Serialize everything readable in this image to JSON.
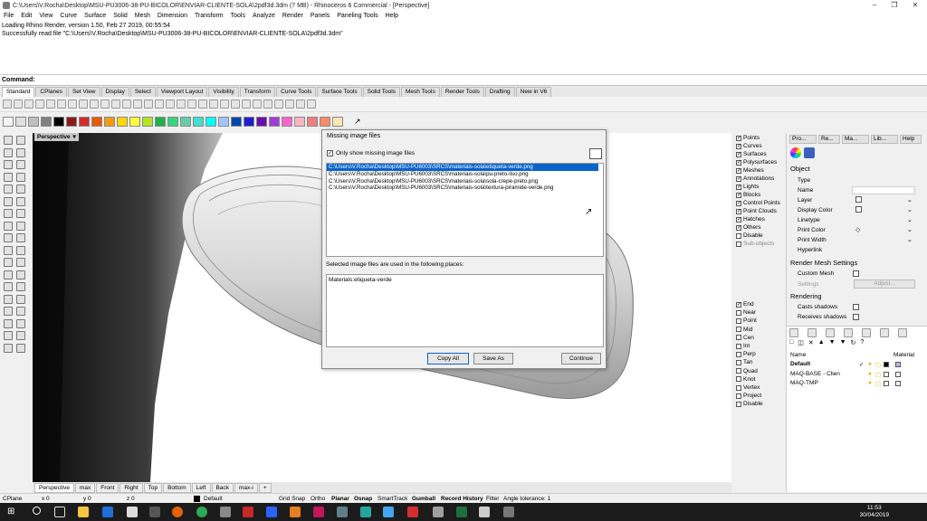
{
  "window": {
    "title": "C:\\Users\\V.Rocha\\Desktop\\MSU-PU3006-38-PU-BICOLOR\\ENVIAR-CLIENTE-SOLA\\2pdf3d.3dm (7 MB) - Rhinoceros 6 Commercial - [Perspective]"
  },
  "menu": [
    "File",
    "Edit",
    "View",
    "Curve",
    "Surface",
    "Solid",
    "Mesh",
    "Dimension",
    "Transform",
    "Tools",
    "Analyze",
    "Render",
    "Panels",
    "Paneling Tools",
    "Help"
  ],
  "history": [
    "Loading Rhino Render, version 1.50, Feb 27 2019, 00:55:54",
    "Successfully read file \"C:\\Users\\V.Rocha\\Desktop\\MSU-PU3006-38-PU-BICOLOR\\ENVIAR-CLIENTE-SOLA\\2pdf3d.3dm\""
  ],
  "command_label": "Command:",
  "toolbar_tabs": [
    "Standard",
    "CPlanes",
    "Set View",
    "Display",
    "Select",
    "Viewport Layout",
    "Visibility",
    "Transform",
    "Curve Tools",
    "Surface Tools",
    "Solid Tools",
    "Mesh Tools",
    "Render Tools",
    "Drafting",
    "New in V6"
  ],
  "swatches": [
    "#f5f5f5",
    "#e0e0e0",
    "#c0c0c0",
    "#808080",
    "#000000",
    "#8b1a1a",
    "#d12b2b",
    "#e85a00",
    "#f39c12",
    "#ffd700",
    "#ffff3c",
    "#b5e61d",
    "#22b14c",
    "#37d67a",
    "#66cdaa",
    "#40e0d0",
    "#00ffff",
    "#a0c4ff",
    "#0047ab",
    "#1e1ecc",
    "#6a0dad",
    "#a53bd6",
    "#ff66cc",
    "#ffb6c1",
    "#f08080",
    "#ff8c69",
    "#ffe4b5"
  ],
  "viewport": {
    "label": "Perspective",
    "tabs": [
      "Perspective",
      "max",
      "Front",
      "Right",
      "Top",
      "Bottom",
      "Left",
      "Back",
      "max-i"
    ],
    "add_icon": "add-viewport-icon"
  },
  "osnap": {
    "filters": [
      {
        "label": "Points",
        "on": true
      },
      {
        "label": "Curves",
        "on": true
      },
      {
        "label": "Surfaces",
        "on": true
      },
      {
        "label": "Polysurfaces",
        "on": true
      },
      {
        "label": "Meshes",
        "on": true
      },
      {
        "label": "Annotations",
        "on": true
      },
      {
        "label": "Lights",
        "on": true
      },
      {
        "label": "Blocks",
        "on": true
      },
      {
        "label": "Control Points",
        "on": true
      },
      {
        "label": "Point Clouds",
        "on": true
      },
      {
        "label": "Hatches",
        "on": true
      },
      {
        "label": "Others",
        "on": true
      },
      {
        "label": "Disable",
        "on": false
      },
      {
        "label": "Sub-objects",
        "on": false,
        "dim": true
      }
    ],
    "snaps": [
      {
        "label": "End",
        "on": true
      },
      {
        "label": "Near",
        "on": false
      },
      {
        "label": "Point",
        "on": false
      },
      {
        "label": "Mid",
        "on": false
      },
      {
        "label": "Cen",
        "on": false
      },
      {
        "label": "Int",
        "on": false
      },
      {
        "label": "Perp",
        "on": false
      },
      {
        "label": "Tan",
        "on": false
      },
      {
        "label": "Quad",
        "on": false
      },
      {
        "label": "Knot",
        "on": false
      },
      {
        "label": "Vertex",
        "on": false
      },
      {
        "label": "Project",
        "on": false
      },
      {
        "label": "Disable",
        "on": false
      }
    ]
  },
  "props": {
    "tabs": [
      "Pro...",
      "Re...",
      "Ma...",
      "Lib...",
      "Help"
    ],
    "object_head": "Object",
    "rows": [
      "Type",
      "Name",
      "Layer",
      "Display Color",
      "Linetype",
      "Print Color",
      "Print Width",
      "Hyperlink"
    ],
    "mesh_head": "Render Mesh Settings",
    "custom_mesh": "Custom Mesh",
    "settings": "Settings",
    "adjust": "Adjust...",
    "rendering_head": "Rendering",
    "casts": "Casts shadows",
    "receives": "Receives shadows"
  },
  "layers": {
    "col_name": "Name",
    "col_material": "Material",
    "items": [
      {
        "name": "Default",
        "bold": true,
        "check": "✓"
      },
      {
        "name": "MAQ-BASE - Clien",
        "bold": false,
        "check": ""
      },
      {
        "name": "MAQ-TMP",
        "bold": false,
        "check": ""
      }
    ]
  },
  "status": {
    "cplane": "CPlane",
    "x": "x 0",
    "y": "y 0",
    "z": "z 0",
    "layer": "Default",
    "toggles": [
      "Grid Snap",
      "Ortho",
      "Planar",
      "Osnap",
      "SmartTrack",
      "Gumball",
      "Record History",
      "Filter"
    ],
    "bold": [
      "Planar",
      "Osnap",
      "Gumball",
      "Record History"
    ],
    "tolerance": "Angle tolerance: 1"
  },
  "taskbar": {
    "time": "11:53",
    "date": "30/04/2019"
  },
  "dialog": {
    "title": "Missing image files",
    "only_show_label": "Only show missing image files",
    "only_show_checked": "✓",
    "files": [
      "C:\\Users\\V.Rocha\\Desktop\\MSU-PU6003\\SRCS\\materiais-sola\\etiqueta-verde.png",
      "C:\\Users\\V.Rocha\\Desktop\\MSU-PU6003\\SRCS\\materiais-sola\\pu-preto-liso.png",
      "C:\\Users\\V.Rocha\\Desktop\\MSU-PU6003\\SRCS\\materiais-sola\\sola-crepe-preto.png",
      "C:\\Users\\V.Rocha\\Desktop\\MSU-PU6003\\SRCS\\materiais-sola\\textura-piramide-verde.png"
    ],
    "used_label": "Selected image files are used in the following places:",
    "used_value": "Materials:etiqueta-verde",
    "copy_all": "Copy All",
    "save_as": "Save As",
    "continue": "Continue"
  }
}
